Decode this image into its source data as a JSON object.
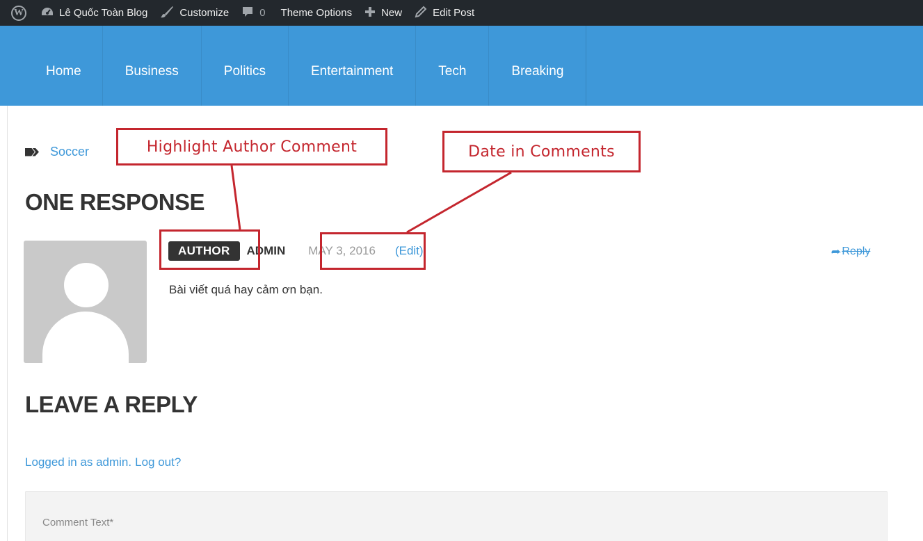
{
  "adminbar": {
    "wp_logo": "W",
    "site_name": "Lê Quốc Toàn Blog",
    "customize": "Customize",
    "comments_count": "0",
    "theme_options": "Theme Options",
    "new": "New",
    "edit_post": "Edit Post",
    "icons": [
      "wordpress-logo",
      "dashboard-icon",
      "brush-icon",
      "comment-bubble-icon",
      "plus-icon",
      "pencil-icon"
    ]
  },
  "nav": {
    "items": [
      "Home",
      "Business",
      "Politics",
      "Entertainment",
      "Tech",
      "Breaking"
    ]
  },
  "post": {
    "tag": "Soccer"
  },
  "comments": {
    "heading": "ONE RESPONSE",
    "items": [
      {
        "badge": "AUTHOR",
        "author": "ADMIN",
        "date": "MAY 3, 2016",
        "edit": "(Edit)",
        "text": "Bài viết quá hay cảm ơn bạn.",
        "reply": "Reply"
      }
    ]
  },
  "reply_form": {
    "heading": "LEAVE A REPLY",
    "logged_in": "Logged in as admin.",
    "logout": "Log out?",
    "comment_placeholder": "Comment Text*"
  },
  "annotations": {
    "highlight_author": "Highlight Author Comment",
    "date_in_comments": "Date in Comments"
  },
  "colors": {
    "adminbar_bg": "#23282d",
    "nav_bg": "#3e98d9",
    "link": "#3e98d9",
    "annotation": "#c4262e"
  }
}
